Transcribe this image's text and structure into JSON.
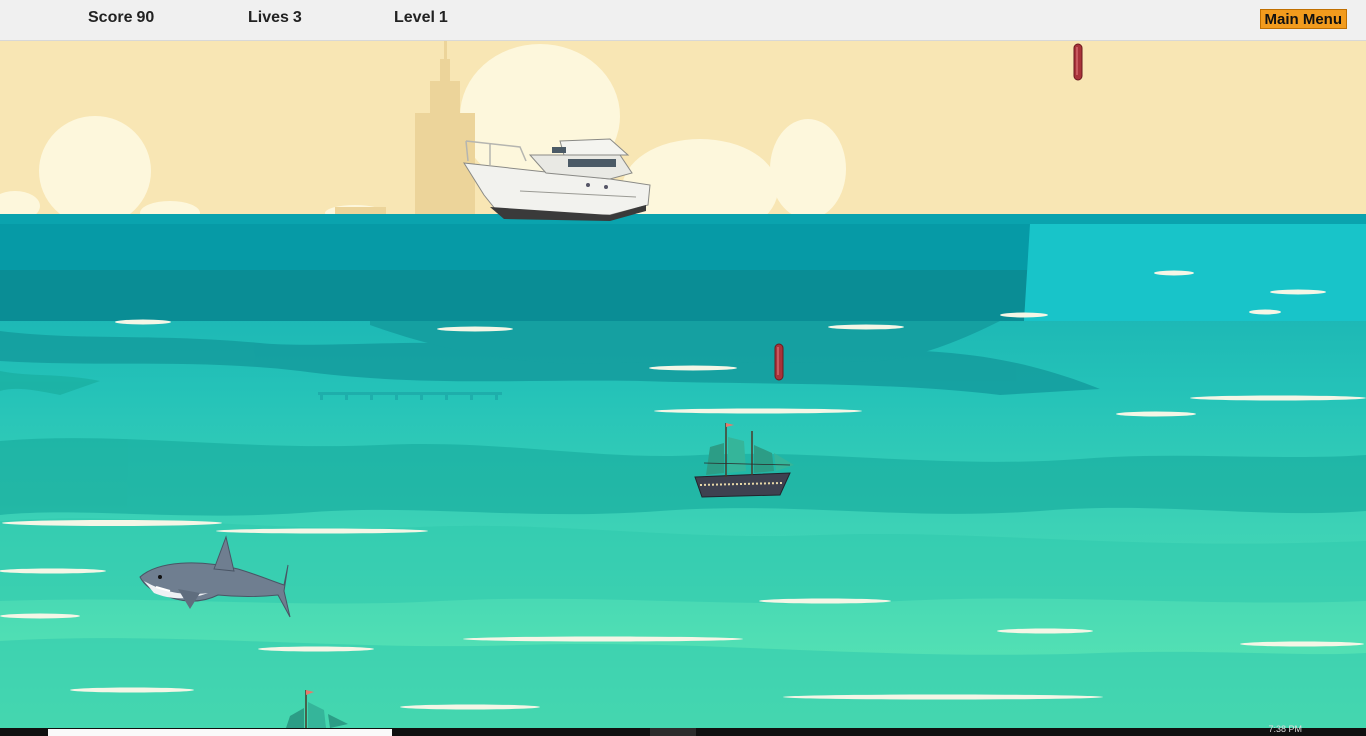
{
  "hud": {
    "score_label": "Score",
    "score_value": "90",
    "lives_label": "Lives",
    "lives_value": "3",
    "level_label": "Level",
    "level_value": "1",
    "menu_label": "Main Menu"
  },
  "taskbar": {
    "clock": "7:38 PM"
  },
  "colors": {
    "sky": "#f8e6b4",
    "sea_top": "#0d9ba8",
    "sea_bottom": "#5fe8b4",
    "button": "#f29b1d",
    "hud_bg": "#f0f0f0"
  },
  "sprites": [
    "yacht",
    "shark",
    "pirate-ship",
    "pirate-ship-partial",
    "red-bomb",
    "red-bomb"
  ]
}
